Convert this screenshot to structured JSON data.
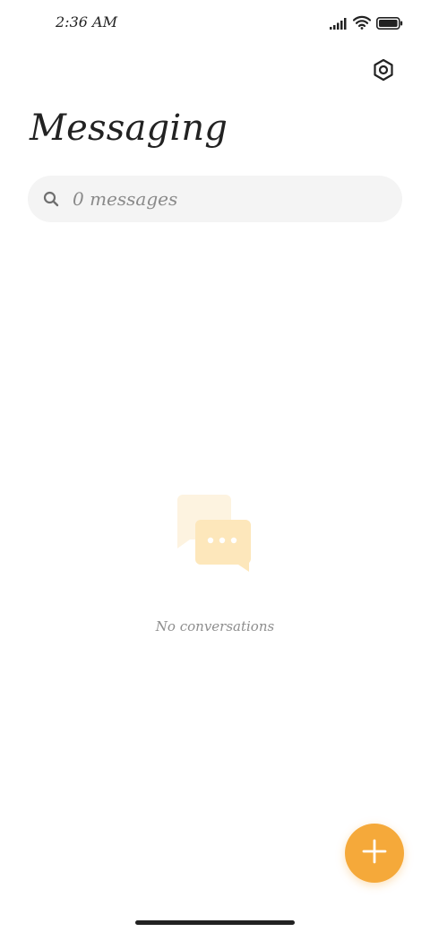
{
  "status_bar": {
    "time": "2:36 AM"
  },
  "header": {
    "title": "Messaging",
    "settings_icon": "settings-gear-icon"
  },
  "search": {
    "placeholder": "0 messages",
    "icon": "search-icon"
  },
  "empty_state": {
    "icon": "chat-bubbles-icon",
    "text": "No conversations"
  },
  "fab": {
    "icon": "plus-icon",
    "color": "#f5a93a"
  },
  "colors": {
    "accent": "#f5a93a",
    "illustration_light": "#fdf3e0",
    "illustration_mid": "#fde7bb"
  }
}
